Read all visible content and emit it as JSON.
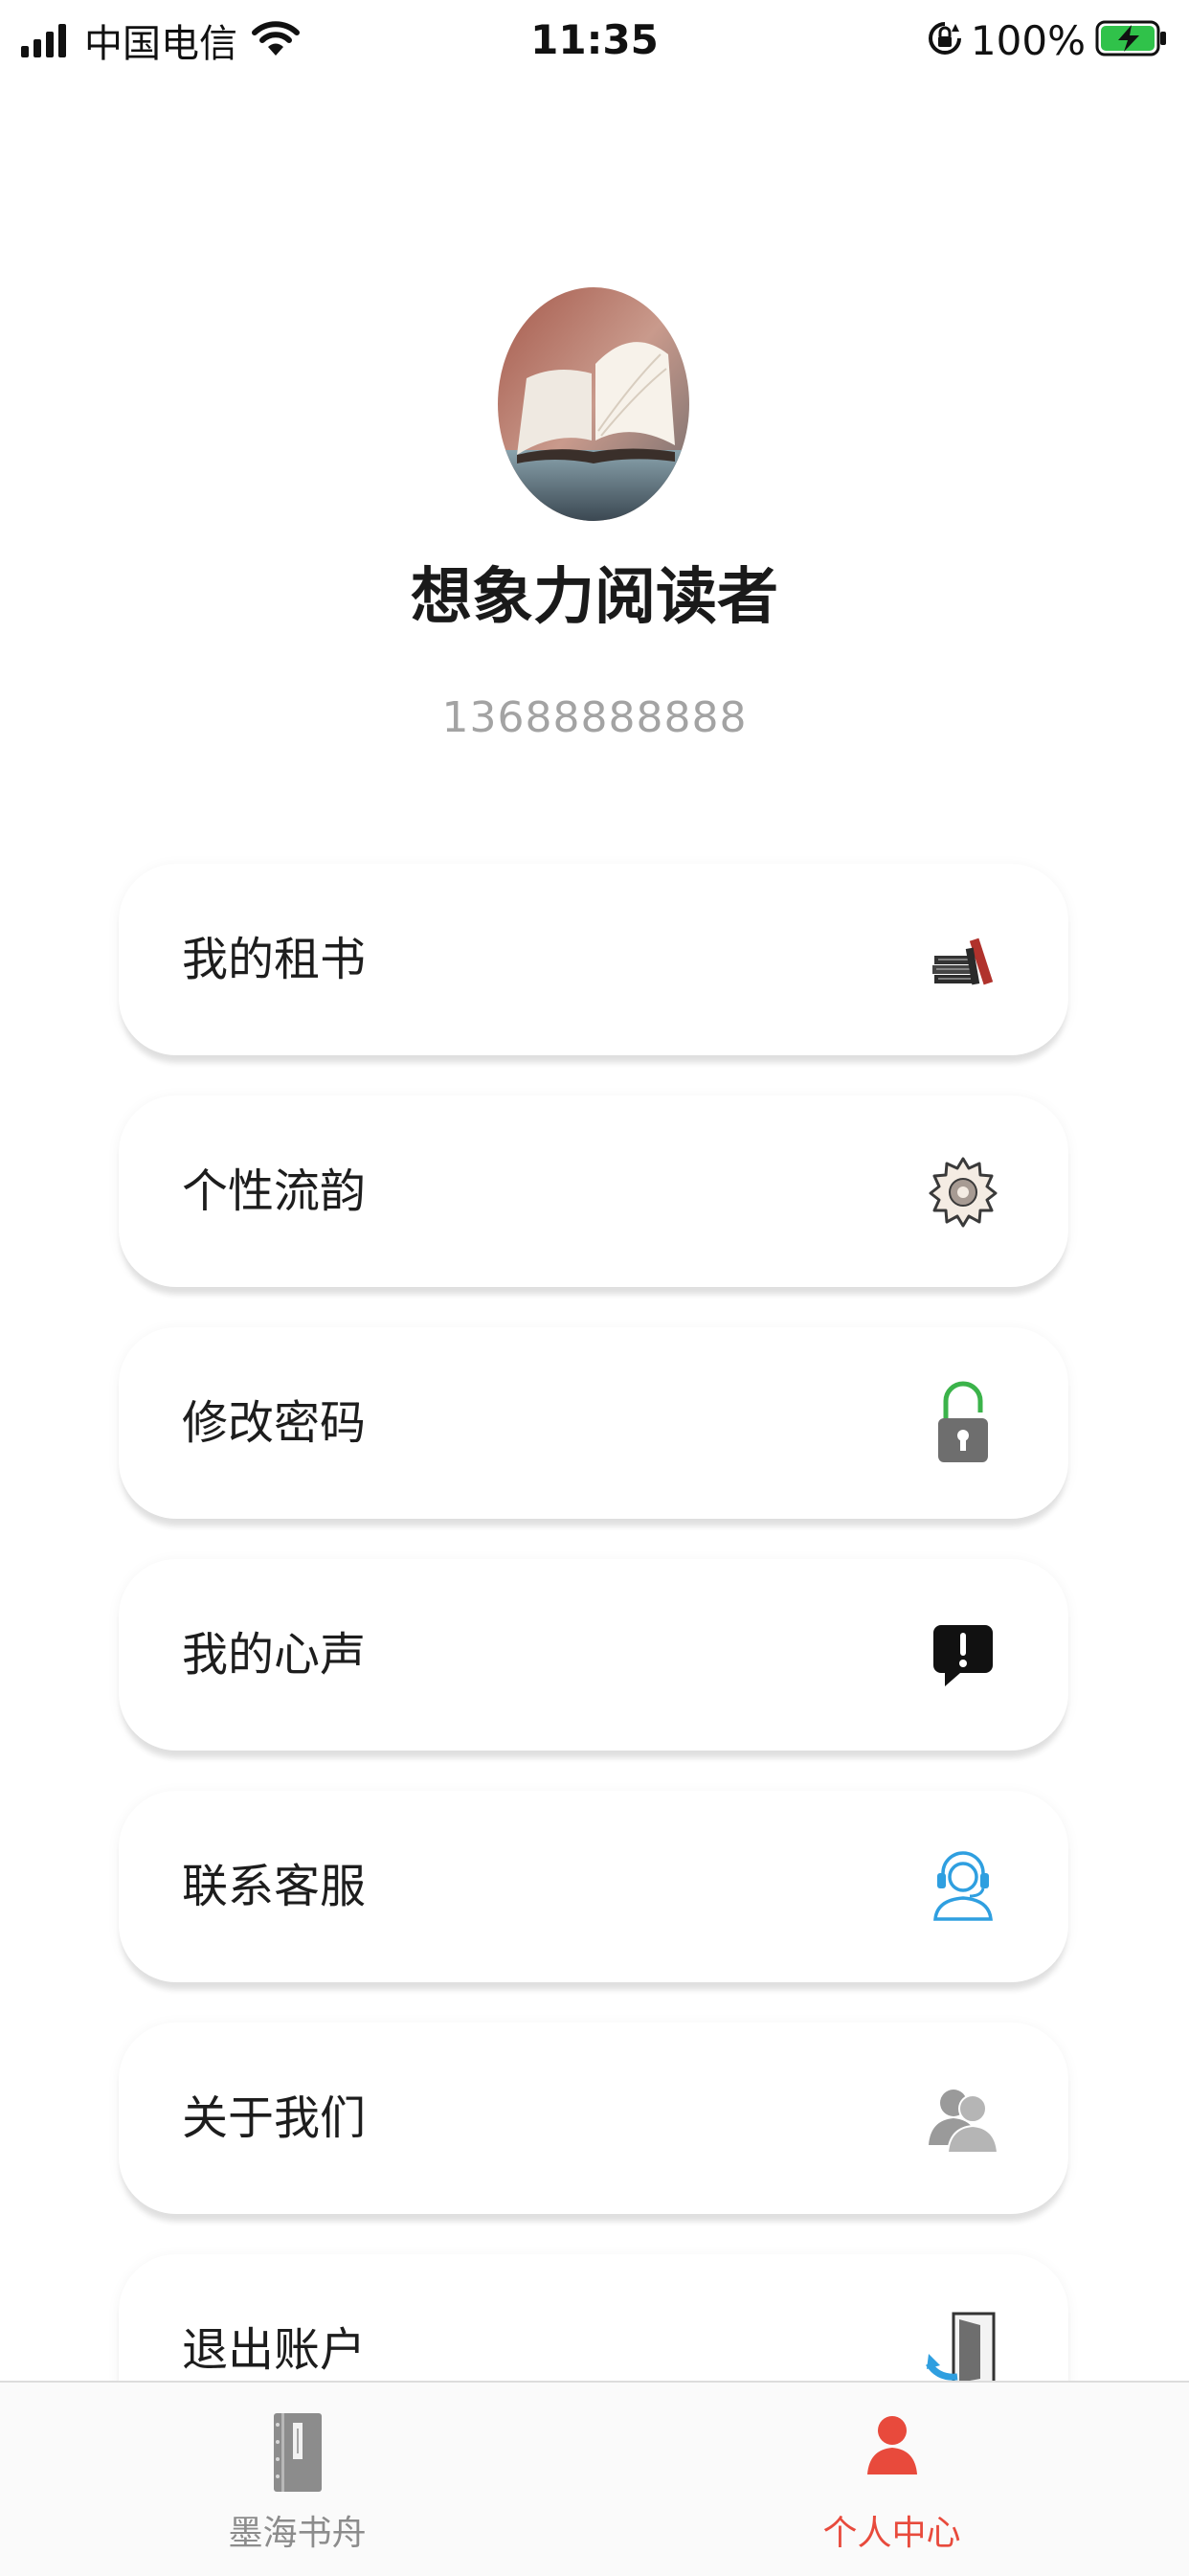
{
  "status_bar": {
    "carrier": "中国电信",
    "time": "11:35",
    "battery_percent": "100%"
  },
  "profile": {
    "username": "想象力阅读者",
    "phone": "13688888888"
  },
  "menu": [
    {
      "label": "我的租书",
      "icon": "books-icon"
    },
    {
      "label": "个性流韵",
      "icon": "gear-icon"
    },
    {
      "label": "修改密码",
      "icon": "unlock-icon"
    },
    {
      "label": "我的心声",
      "icon": "feedback-icon"
    },
    {
      "label": "联系客服",
      "icon": "customer-service-icon"
    },
    {
      "label": "关于我们",
      "icon": "users-icon"
    },
    {
      "label": "退出账户",
      "icon": "logout-icon"
    }
  ],
  "tabs": [
    {
      "label": "墨海书舟",
      "icon": "book-icon",
      "active": false
    },
    {
      "label": "个人中心",
      "icon": "user-icon",
      "active": true
    }
  ],
  "colors": {
    "active_tab": "#e84a3c",
    "inactive_tab": "#8c8c8c",
    "phone_text": "#a3a3a3",
    "unlock_green": "#3bb34a",
    "service_blue": "#2f9fe0",
    "battery_green": "#30c24a"
  }
}
